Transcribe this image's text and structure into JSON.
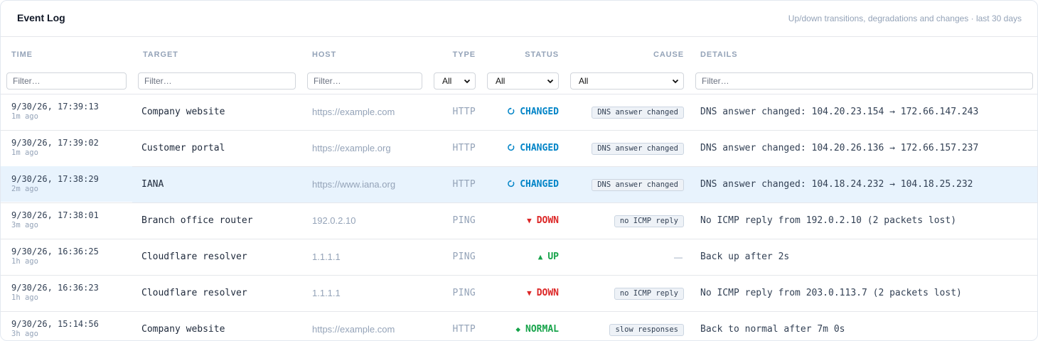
{
  "header": {
    "title": "Event Log",
    "subtitle": "Up/down transitions, degradations and changes · last 30 days"
  },
  "columns": {
    "time": "TIME",
    "target": "TARGET",
    "host": "HOST",
    "type": "TYPE",
    "status": "STATUS",
    "cause": "CAUSE",
    "details": "DETAILS"
  },
  "filters": {
    "time_placeholder": "Filter…",
    "target_placeholder": "Filter…",
    "host_placeholder": "Filter…",
    "type_value": "All",
    "status_value": "All",
    "cause_value": "All",
    "details_placeholder": "Filter…"
  },
  "colors": {
    "changed": "#0284c7",
    "down": "#dc2626",
    "up": "#16a34a",
    "highlight_row": "#e8f3fd"
  },
  "rows": [
    {
      "time": "9/30/26, 17:39:13",
      "ago": "1m ago",
      "target": "Company website",
      "host": "https://example.com",
      "type": "HTTP",
      "status": "CHANGED",
      "status_icon": "refresh-icon",
      "cause": "DNS answer changed",
      "details": "DNS answer changed: 104.20.23.154 → 172.66.147.243"
    },
    {
      "time": "9/30/26, 17:39:02",
      "ago": "1m ago",
      "target": "Customer portal",
      "host": "https://example.org",
      "type": "HTTP",
      "status": "CHANGED",
      "status_icon": "refresh-icon",
      "cause": "DNS answer changed",
      "details": "DNS answer changed: 104.20.26.136 → 172.66.157.237"
    },
    {
      "time": "9/30/26, 17:38:29",
      "ago": "2m ago",
      "target": "IANA",
      "host": "https://www.iana.org",
      "type": "HTTP",
      "status": "CHANGED",
      "status_icon": "refresh-icon",
      "cause": "DNS answer changed",
      "details": "DNS answer changed: 104.18.24.232 → 104.18.25.232",
      "highlighted": true
    },
    {
      "time": "9/30/26, 17:38:01",
      "ago": "3m ago",
      "target": "Branch office router",
      "host": "192.0.2.10",
      "type": "PING",
      "status": "DOWN",
      "status_icon": "triangle-down-icon",
      "cause": "no ICMP reply",
      "details": "No ICMP reply from 192.0.2.10 (2 packets lost)"
    },
    {
      "time": "9/30/26, 16:36:25",
      "ago": "1h ago",
      "target": "Cloudflare resolver",
      "host": "1.1.1.1",
      "type": "PING",
      "status": "UP",
      "status_icon": "triangle-up-icon",
      "cause": "—",
      "details": "Back up after 2s"
    },
    {
      "time": "9/30/26, 16:36:23",
      "ago": "1h ago",
      "target": "Cloudflare resolver",
      "host": "1.1.1.1",
      "type": "PING",
      "status": "DOWN",
      "status_icon": "triangle-down-icon",
      "cause": "no ICMP reply",
      "details": "No ICMP reply from 203.0.113.7 (2 packets lost)"
    },
    {
      "time": "9/30/26, 15:14:56",
      "ago": "3h ago",
      "target": "Company website",
      "host": "https://example.com",
      "type": "HTTP",
      "status": "NORMAL",
      "status_icon": "diamond-icon",
      "cause": "slow responses",
      "details": "Back to normal after 7m 0s"
    }
  ]
}
